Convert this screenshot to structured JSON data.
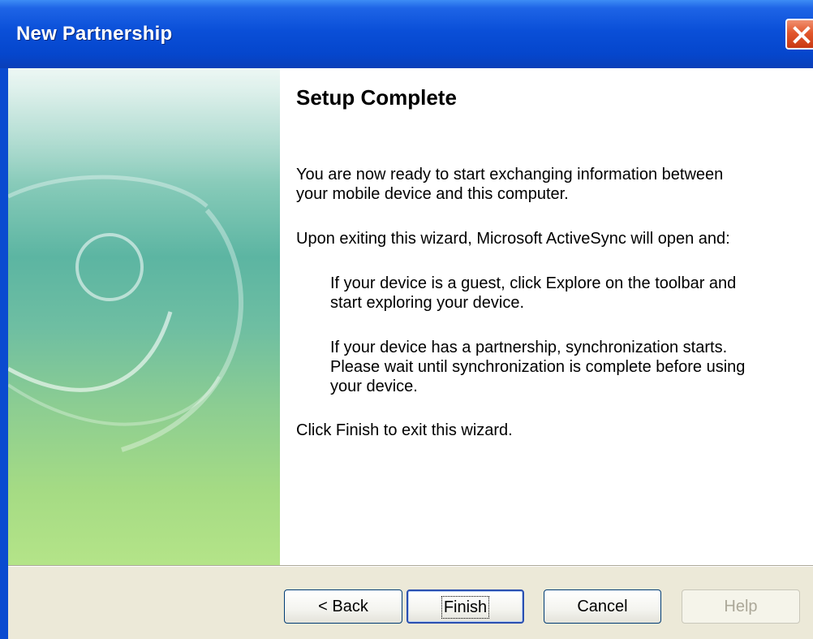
{
  "window": {
    "title": "New Partnership"
  },
  "content": {
    "heading": "Setup Complete",
    "paragraph1": [
      "You are now ready to start exchanging information between",
      "your mobile device and this computer."
    ],
    "paragraph2": "Upon exiting this wizard, Microsoft ActiveSync will open and:",
    "bullet1": [
      "If your device is a guest, click Explore on the toolbar and",
      "start exploring your device."
    ],
    "bullet2": [
      "If your device has a partnership, synchronization starts.",
      "Please wait until synchronization is complete before using",
      "your device."
    ],
    "paragraph3": "Click Finish to exit this wizard."
  },
  "buttons": {
    "back": "< Back",
    "finish": "Finish",
    "cancel": "Cancel",
    "help": "Help"
  }
}
